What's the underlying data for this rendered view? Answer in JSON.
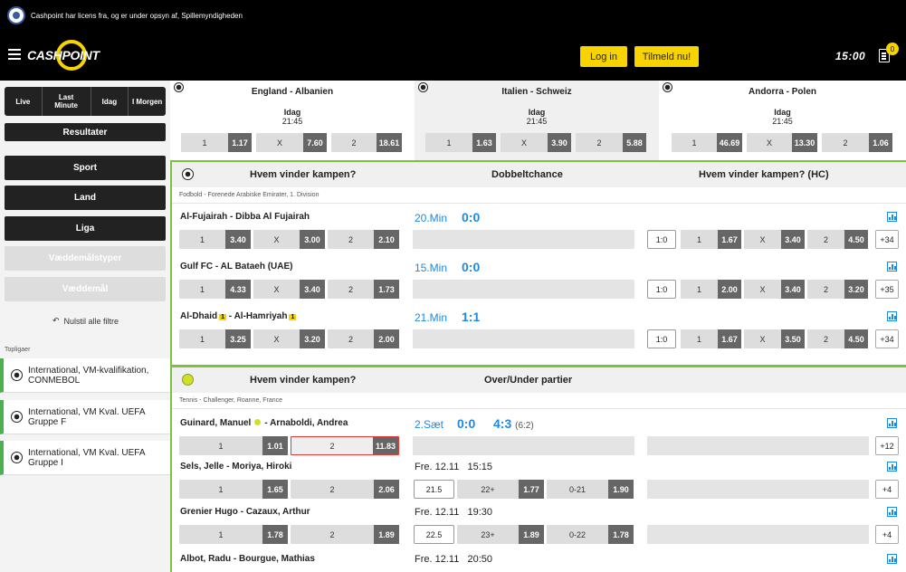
{
  "license": "Cashpoint har licens fra, og er under opsyn af, Spillemyndigheden",
  "header": {
    "logo": "CASHPOINT",
    "login": "Log in",
    "signup": "Tilmeld nu!",
    "clock": "15:00",
    "bet_count": "0"
  },
  "sidebar": {
    "tabs": [
      "Live",
      "Last Minute",
      "Idag",
      "I Morgen"
    ],
    "results": "Resultater",
    "sport": "Sport",
    "land": "Land",
    "liga": "Liga",
    "bet_types": "Væddemålstyper",
    "bets": "Væddemål",
    "reset": "Nulstil alle filtre",
    "topligaer": "Topligaer",
    "leagues": [
      "International, VM-kvalifikation, CONMEBOL",
      "International, VM Kval. UEFA Gruppe F",
      "International, VM Kval. UEFA Gruppe I"
    ]
  },
  "featured": [
    {
      "teams": "England - Albanien",
      "day": "Idag",
      "time": "21:45",
      "odds": [
        [
          "1",
          "1.17"
        ],
        [
          "X",
          "7.60"
        ],
        [
          "2",
          "18.61"
        ]
      ]
    },
    {
      "teams": "Italien - Schweiz",
      "day": "Idag",
      "time": "21:45",
      "odds": [
        [
          "1",
          "1.63"
        ],
        [
          "X",
          "3.90"
        ],
        [
          "2",
          "5.88"
        ]
      ]
    },
    {
      "teams": "Andorra - Polen",
      "day": "Idag",
      "time": "21:45",
      "odds": [
        [
          "1",
          "46.69"
        ],
        [
          "X",
          "13.30"
        ],
        [
          "2",
          "1.06"
        ]
      ]
    }
  ],
  "football": {
    "h1": "Hvem vinder kampen?",
    "h2": "Dobbeltchance",
    "h3": "Hvem vinder kampen? (HC)",
    "league": "Fodbold - Forenede Arabiske Emirater, 1. Division",
    "matches": [
      {
        "home": "Al-Fujairah",
        "away": "Dibba Al Fujairah",
        "min": "20.Min",
        "score": "0:0",
        "o1": "3.40",
        "ox": "3.00",
        "o2": "2.10",
        "hc": "1:0",
        "h1": "1.67",
        "hx": "3.40",
        "h2": "4.50",
        "more": "+34"
      },
      {
        "home": "Gulf FC",
        "away": "AL Bataeh (UAE)",
        "min": "15.Min",
        "score": "0:0",
        "o1": "4.33",
        "ox": "3.40",
        "o2": "1.73",
        "hc": "1:0",
        "h1": "2.00",
        "hx": "3.40",
        "h2": "3.20",
        "more": "+35"
      },
      {
        "home": "Al-Dhaid",
        "away": "Al-Hamriyah",
        "min": "21.Min",
        "score": "1:1",
        "o1": "3.25",
        "ox": "3.20",
        "o2": "2.00",
        "hc": "1:0",
        "h1": "1.67",
        "hx": "3.50",
        "h2": "4.50",
        "more": "+34",
        "home_card": "1",
        "away_card": "1"
      }
    ]
  },
  "tennis": {
    "h1": "Hvem vinder kampen?",
    "h2": "Over/Under partier",
    "league": "Tennis - Challenger, Roanne, France",
    "matches": [
      {
        "home": "Guinard, Manuel",
        "away": "Arnaboldi, Andrea",
        "set": "2.Sæt",
        "score": "0:0",
        "games": "4:3",
        "detail": "(6:2)",
        "o1": "1.01",
        "o2": "11.83",
        "more": "+12"
      },
      {
        "home": "Sels, Jelle",
        "away": "Moriya, Hiroki",
        "date": "Fre. 12.11",
        "time": "15:15",
        "o1": "1.65",
        "o2": "2.06",
        "line": "21.5",
        "over": "22+",
        "ov": "1.77",
        "under": "0-21",
        "uv": "1.90",
        "more": "+4"
      },
      {
        "home": "Grenier Hugo",
        "away": "Cazaux, Arthur",
        "date": "Fre. 12.11",
        "time": "19:30",
        "o1": "1.78",
        "o2": "1.89",
        "line": "22.5",
        "over": "23+",
        "ov": "1.89",
        "under": "0-22",
        "uv": "1.78",
        "more": "+4"
      },
      {
        "home": "Albot, Radu",
        "away": "Bourgue, Mathias",
        "date": "Fre. 12.11",
        "time": "20:50"
      }
    ]
  },
  "labels": {
    "one": "1",
    "x": "X",
    "two": "2",
    "dash": "-"
  }
}
